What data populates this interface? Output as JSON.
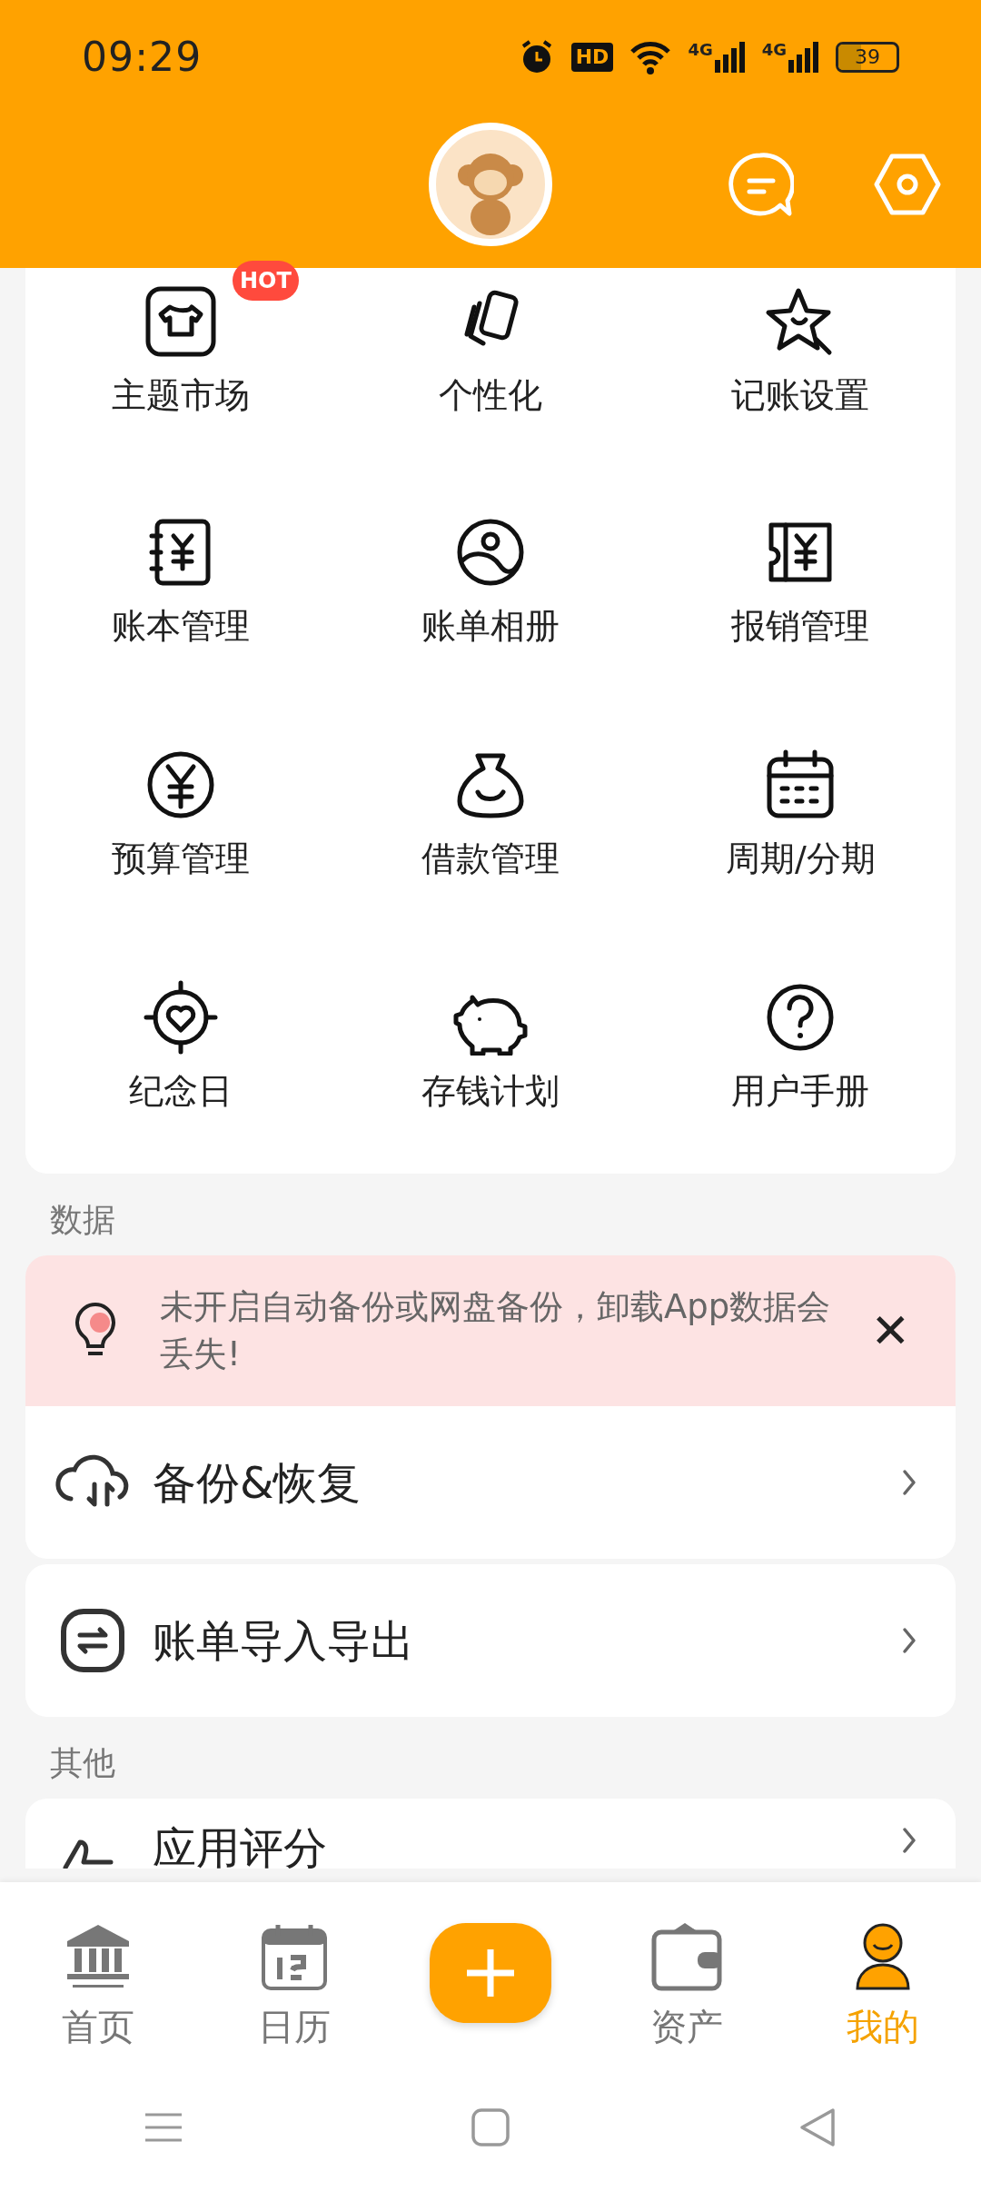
{
  "status_bar": {
    "time": "09:29",
    "hd": "HD",
    "networks": [
      "4G",
      "4G"
    ],
    "battery": "39"
  },
  "features": [
    {
      "label": "主题市场",
      "badge": "HOT"
    },
    {
      "label": "个性化"
    },
    {
      "label": "记账设置"
    },
    {
      "label": "账本管理"
    },
    {
      "label": "账单相册"
    },
    {
      "label": "报销管理"
    },
    {
      "label": "预算管理"
    },
    {
      "label": "借款管理"
    },
    {
      "label": "周期/分期"
    },
    {
      "label": "纪念日"
    },
    {
      "label": "存钱计划"
    },
    {
      "label": "用户手册"
    }
  ],
  "data_section": {
    "title": "数据",
    "notice": {
      "text": "未开启自动备份或网盘备份，卸载App数据会丢失!",
      "close": "✕"
    },
    "rows": [
      {
        "label": "备份&恢复"
      },
      {
        "label": "账单导入导出"
      }
    ]
  },
  "other_section": {
    "title": "其他",
    "rows": [
      {
        "label": "应用评分"
      }
    ]
  },
  "tab_bar": [
    {
      "kind": "tab",
      "label": "首页",
      "selected": false
    },
    {
      "kind": "tab",
      "label": "日历",
      "selected": false
    },
    {
      "kind": "add"
    },
    {
      "kind": "tab",
      "label": "资产",
      "selected": false
    },
    {
      "kind": "tab",
      "label": "我的",
      "selected": true
    }
  ]
}
